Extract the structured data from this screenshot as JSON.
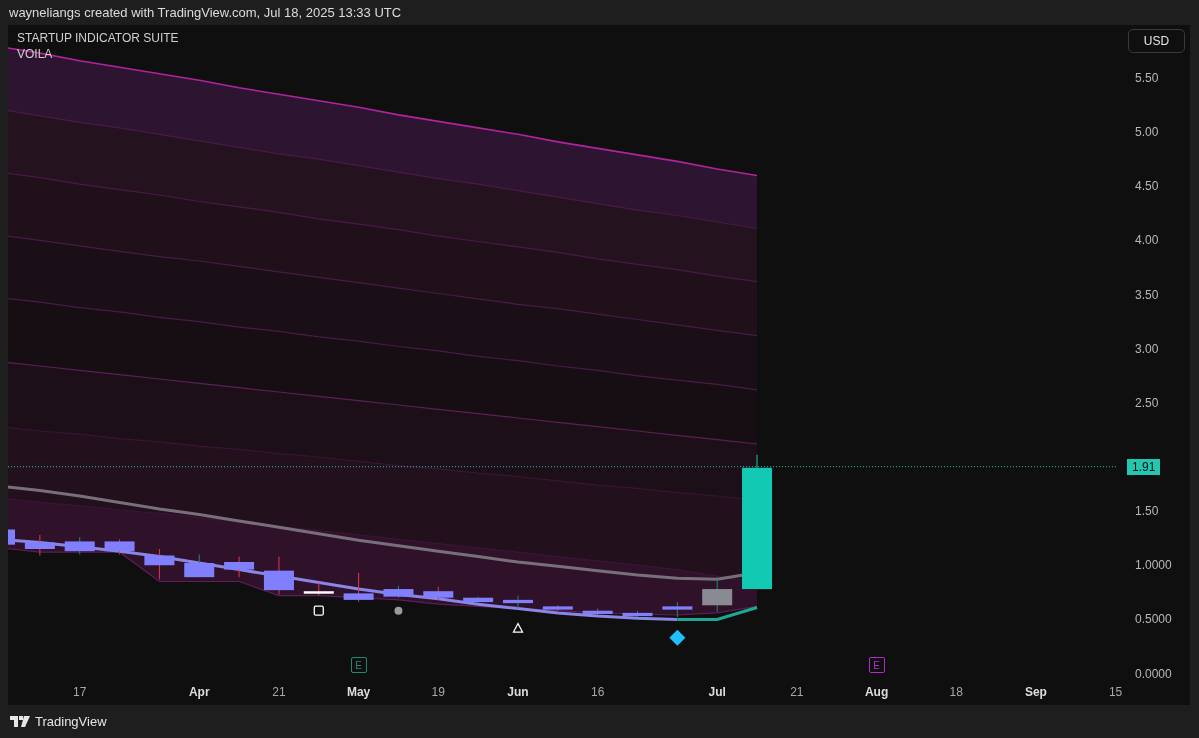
{
  "header": {
    "text": "wayneliangs created with TradingView.com, Jul 18, 2025 13:33 UTC"
  },
  "legend": {
    "title": "STARTUP INDICATOR SUITE",
    "subtitle": "VOILA"
  },
  "currency_button": {
    "label": "USD"
  },
  "price_axis": [
    {
      "label": "5.50"
    },
    {
      "label": "5.00"
    },
    {
      "label": "4.50"
    },
    {
      "label": "4.00"
    },
    {
      "label": "3.50"
    },
    {
      "label": "3.00"
    },
    {
      "label": "2.50"
    },
    {
      "label": "1.50"
    },
    {
      "label": "1.0000"
    },
    {
      "label": "0.5000"
    },
    {
      "label": "0.0000"
    }
  ],
  "last_price": {
    "label": "1.91"
  },
  "time_axis": [
    {
      "label": "17",
      "kind": "day"
    },
    {
      "label": "Apr",
      "kind": "month"
    },
    {
      "label": "21",
      "kind": "day"
    },
    {
      "label": "May",
      "kind": "month"
    },
    {
      "label": "19",
      "kind": "day"
    },
    {
      "label": "Jun",
      "kind": "month"
    },
    {
      "label": "16",
      "kind": "day"
    },
    {
      "label": "Jul",
      "kind": "month"
    },
    {
      "label": "21",
      "kind": "day"
    },
    {
      "label": "Aug",
      "kind": "month"
    },
    {
      "label": "18",
      "kind": "day"
    },
    {
      "label": "Sep",
      "kind": "month"
    },
    {
      "label": "15",
      "kind": "day"
    }
  ],
  "events": [
    {
      "label": "E",
      "color": "#1f8a70"
    },
    {
      "label": "E",
      "color": "#b02ad0"
    }
  ],
  "footer": {
    "brand": "TradingView"
  }
}
